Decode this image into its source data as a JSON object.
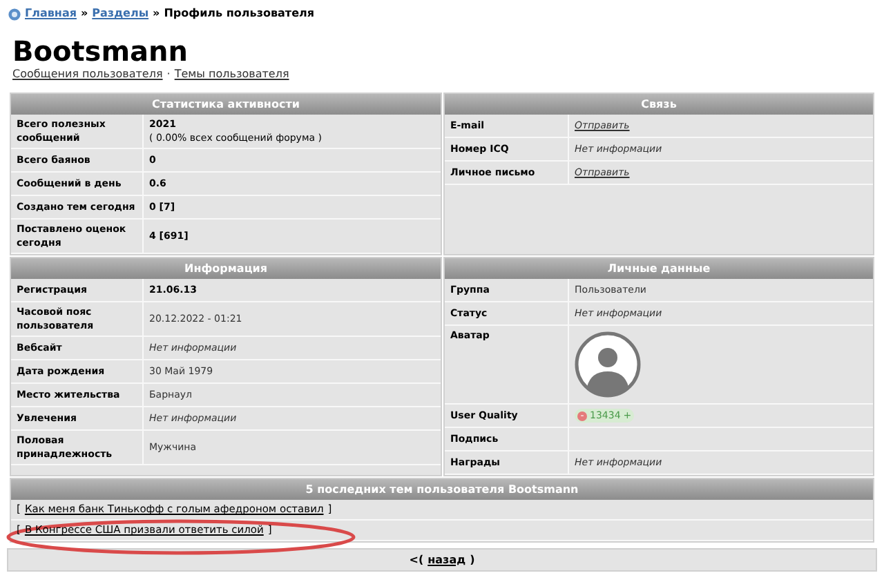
{
  "breadcrumb": {
    "links": [
      "Главная",
      "Разделы"
    ],
    "separator": "»",
    "current": "Профиль пользователя"
  },
  "title": "Bootsmann",
  "user_links": {
    "items": [
      "Сообщения пользователя",
      "Темы пользователя"
    ],
    "separator": "·"
  },
  "panels": [
    {
      "title": "Статистика активности",
      "rows": [
        {
          "label": "Всего полезных сообщений",
          "kind": "bold",
          "value": "2021",
          "note": "( 0.00% всех сообщений форума )"
        },
        {
          "label": "Всего баянов",
          "kind": "bold",
          "value": "0"
        },
        {
          "label": "Сообщений в день",
          "kind": "bold",
          "value": "0.6"
        },
        {
          "label": "Создано тем сегодня",
          "kind": "bold",
          "value": "0 [7]"
        },
        {
          "label": "Поставлено оценок сегодня",
          "kind": "bold",
          "value": "4 [691]"
        }
      ]
    },
    {
      "title": "Связь",
      "rows": [
        {
          "label": "E-mail",
          "kind": "link",
          "value": "Отправить"
        },
        {
          "label": "Номер ICQ",
          "kind": "muted",
          "value": "Нет информации"
        },
        {
          "label": "Личное письмо",
          "kind": "link",
          "value": "Отправить"
        }
      ]
    },
    {
      "title": "Информация",
      "rows": [
        {
          "label": "Регистрация",
          "kind": "bold",
          "value": "21.06.13"
        },
        {
          "label": "Часовой пояс пользователя",
          "kind": "plain",
          "value": "20.12.2022 - 01:21"
        },
        {
          "label": "Вебсайт",
          "kind": "muted",
          "value": "Нет информации"
        },
        {
          "label": "Дата рождения",
          "kind": "plain",
          "value": "30 Май 1979"
        },
        {
          "label": "Место жительства",
          "kind": "plain",
          "value": "Барнаул"
        },
        {
          "label": "Увлечения",
          "kind": "muted",
          "value": "Нет информации"
        },
        {
          "label": "Половая принадлежность",
          "kind": "plain",
          "value": "Мужчина"
        }
      ]
    },
    {
      "title": "Личные данные",
      "rows": [
        {
          "label": "Группа",
          "kind": "plain",
          "value": "Пользователи"
        },
        {
          "label": "Статус",
          "kind": "muted",
          "value": "Нет информации"
        },
        {
          "label": "Аватар",
          "kind": "avatar"
        },
        {
          "label": "User Quality",
          "kind": "rating",
          "value": "13434",
          "minus": "-",
          "plus": "+"
        },
        {
          "label": "Подпись",
          "kind": "empty"
        },
        {
          "label": "Награды",
          "kind": "muted",
          "value": "Нет информации"
        }
      ]
    }
  ],
  "recent_topics": {
    "title": "5 последних тем пользователя Bootsmann",
    "items": [
      {
        "open": "[",
        "title": "Как меня банк Тинькофф с голым афедроном оставил",
        "close": "]",
        "circled": false
      },
      {
        "open": "[",
        "title": "В Конгрессе США призвали ответить силой",
        "close": "]",
        "circled": true
      }
    ]
  },
  "back": {
    "prefix": "<(",
    "label": "назад",
    "suffix": ")"
  }
}
